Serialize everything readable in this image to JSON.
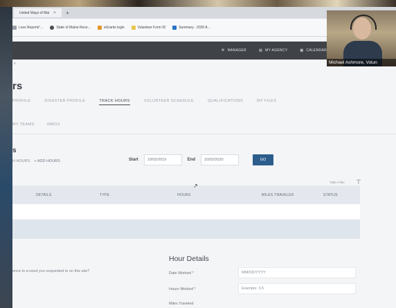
{
  "browser": {
    "tab_title": "United Ways of Mai",
    "tab_close": "×",
    "new_tab": "+",
    "bookmarks": [
      {
        "label": "Loss Reports\"...",
        "color": "#9aa0a8"
      },
      {
        "label": "State of Maine Rece...",
        "color": "#4a4a4a"
      },
      {
        "label": "eGrants login",
        "color": "#e2972b"
      },
      {
        "label": "Volunteer Form ID",
        "color": "#e8c64a"
      },
      {
        "label": "Summary - 2020 A...",
        "color": "#2a72c8"
      }
    ],
    "address_fragment": "s"
  },
  "nav": {
    "items": [
      {
        "label": "MANAGER",
        "icon": "wrench-icon"
      },
      {
        "label": "MY AGENCY",
        "icon": "building-icon"
      },
      {
        "label": "CALENDAR",
        "icon": "calendar-icon"
      }
    ]
  },
  "page": {
    "title": "rs",
    "tabs_row1": [
      "PROFILE",
      "DISASTER PROFILE",
      "TRACK HOURS",
      "VOLUNTEER SCHEDULE",
      "QUALIFICATIONS",
      "MY FILES"
    ],
    "active_tab": "TRACK HOURS",
    "tabs_row2": [
      "MY TEAMS",
      "INBOX"
    ],
    "section_title": "s",
    "hours_btn_1": "H HOURS",
    "hours_btn_2": "ADD HOURS",
    "start_label": "Start",
    "start_value": "10/02/2019",
    "end_label": "End",
    "end_value": "10/02/2020",
    "go_label": "GO",
    "table_filter_label": "Table Filter"
  },
  "table": {
    "headers": [
      "DETAILS",
      "TYPE",
      "HOURS",
      "MILES TRAVELED",
      "STATUS"
    ]
  },
  "details": {
    "title": "Hour Details",
    "question": "ence to a need you responded to on this site?",
    "fields": [
      {
        "label": "Date Worked *",
        "placeholder": "MM/DD/YYYY"
      },
      {
        "label": "Hours Worked *",
        "placeholder": "Example: 3.5"
      },
      {
        "label": "Miles Traveled",
        "placeholder": ""
      }
    ]
  },
  "video": {
    "name": "Michael Ashmore, Volun"
  }
}
